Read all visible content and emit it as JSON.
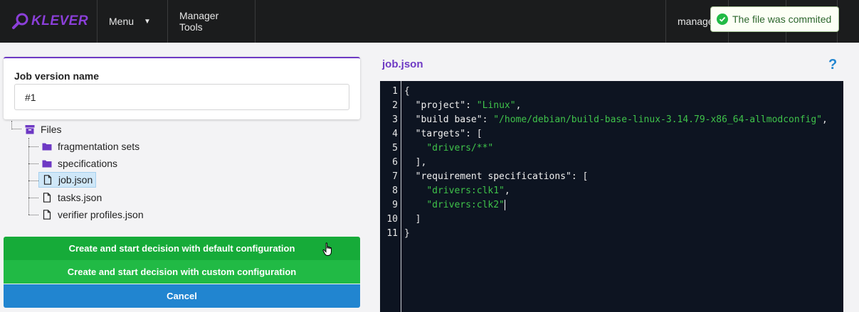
{
  "header": {
    "logo_text": "KLEVER",
    "menu_label": "Menu",
    "manager_tools_label": "Manager Tools",
    "user_label": "manager"
  },
  "toast": {
    "message": "The file was commited"
  },
  "version": {
    "label": "Job version name",
    "value": "#1"
  },
  "tree": {
    "root": "Files",
    "items": [
      {
        "label": "fragmentation sets",
        "type": "folder"
      },
      {
        "label": "specifications",
        "type": "folder"
      },
      {
        "label": "job.json",
        "type": "file",
        "selected": true
      },
      {
        "label": "tasks.json",
        "type": "file"
      },
      {
        "label": "verifier profiles.json",
        "type": "file"
      }
    ]
  },
  "buttons": {
    "default_config": "Create and start decision with default configuration",
    "custom_config": "Create and start decision with custom configuration",
    "cancel": "Cancel"
  },
  "editor": {
    "title": "job.json",
    "help_icon": "?",
    "line_numbers": [
      "1",
      "2",
      "3",
      "4",
      "5",
      "6",
      "7",
      "8",
      "9",
      "10",
      "11"
    ],
    "lines": [
      {
        "parts": [
          [
            "p",
            "{"
          ]
        ]
      },
      {
        "parts": [
          [
            "p",
            "  "
          ],
          [
            "k",
            "\"project\""
          ],
          [
            "p",
            ": "
          ],
          [
            "s",
            "\"Linux\""
          ],
          [
            "p",
            ","
          ]
        ]
      },
      {
        "parts": [
          [
            "p",
            "  "
          ],
          [
            "k",
            "\"build base\""
          ],
          [
            "p",
            ": "
          ],
          [
            "s",
            "\"/home/debian/build-base-linux-3.14.79-x86_64-allmodconfig\""
          ],
          [
            "p",
            ","
          ]
        ]
      },
      {
        "parts": [
          [
            "p",
            "  "
          ],
          [
            "k",
            "\"targets\""
          ],
          [
            "p",
            ": ["
          ]
        ]
      },
      {
        "parts": [
          [
            "p",
            "    "
          ],
          [
            "s",
            "\"drivers/**\""
          ]
        ]
      },
      {
        "parts": [
          [
            "p",
            "  ],"
          ]
        ]
      },
      {
        "parts": [
          [
            "p",
            "  "
          ],
          [
            "k",
            "\"requirement specifications\""
          ],
          [
            "p",
            ": ["
          ]
        ]
      },
      {
        "parts": [
          [
            "p",
            "    "
          ],
          [
            "s",
            "\"drivers:clk1\""
          ],
          [
            "p",
            ","
          ]
        ]
      },
      {
        "parts": [
          [
            "p",
            "    "
          ],
          [
            "s",
            "\"drivers:clk2\""
          ],
          [
            "c",
            ""
          ]
        ]
      },
      {
        "parts": [
          [
            "p",
            "  ]"
          ]
        ]
      },
      {
        "parts": [
          [
            "p",
            "}"
          ]
        ]
      }
    ]
  },
  "colors": {
    "accent": "#6e39c4",
    "topbar": "#1b1c1d",
    "success": "#21ba45",
    "primary": "#2185d0",
    "editor_bg": "#0d1421",
    "string": "#3fc24a"
  }
}
